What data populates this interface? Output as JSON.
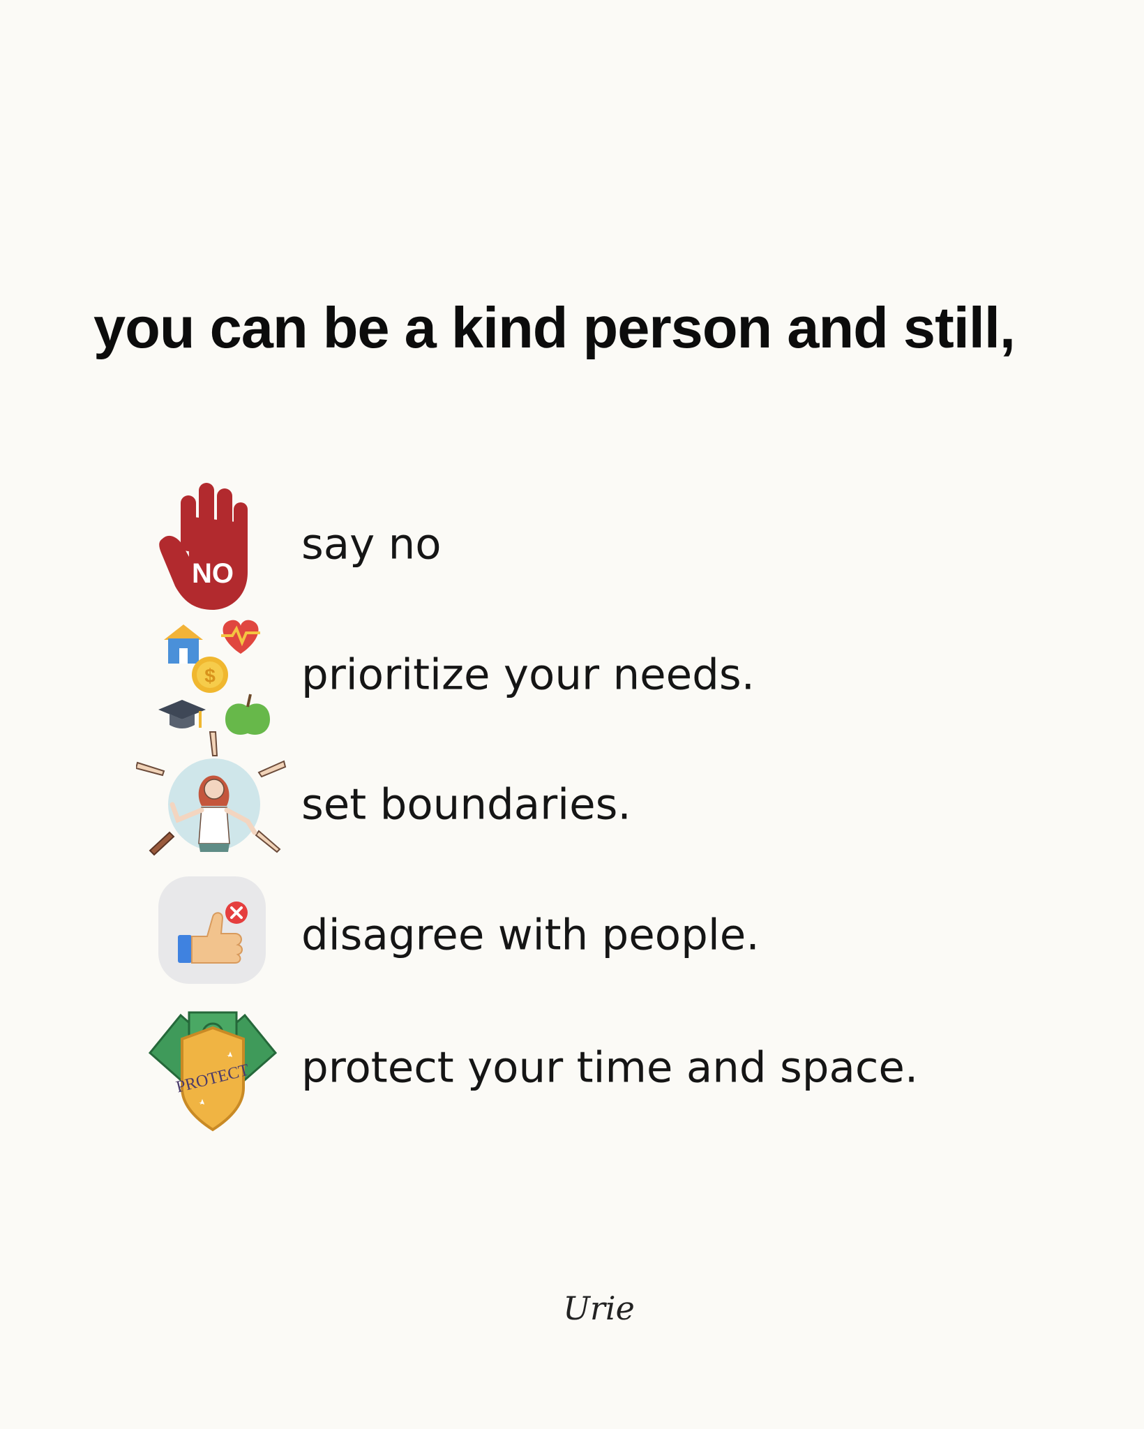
{
  "title": "you can be a kind person and still,",
  "items": [
    {
      "label": "say no",
      "icon": "stop-hand-no-icon",
      "badge": "NO"
    },
    {
      "label": "prioritize your needs.",
      "icon": "priorities-icon"
    },
    {
      "label": "set boundaries.",
      "icon": "boundaries-person-icon"
    },
    {
      "label": "disagree with people.",
      "icon": "thumbs-up-cancel-icon"
    },
    {
      "label": "protect your time and space.",
      "icon": "protect-shield-icon",
      "badge": "PROTECT"
    }
  ],
  "signature": "Urie",
  "colors": {
    "background": "#fbfaf6",
    "text": "#111111",
    "hand": "#b0292d",
    "money": "#3f9a5a",
    "shield": "#f0b443"
  }
}
